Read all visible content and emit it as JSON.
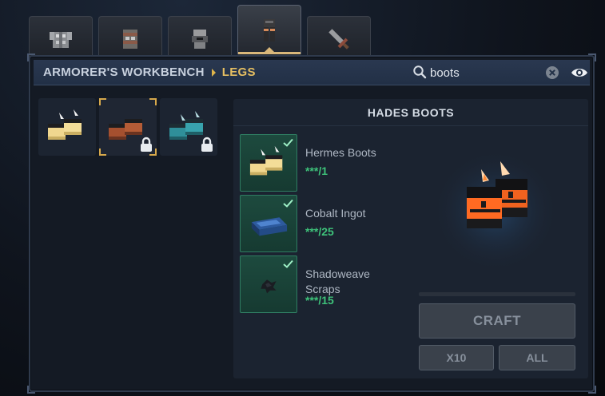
{
  "tabs": [
    {
      "id": "chest",
      "icon": "chestplate-icon",
      "active": false
    },
    {
      "id": "helmet",
      "icon": "helmet-icon",
      "active": false
    },
    {
      "id": "armor",
      "icon": "armor-icon",
      "active": false
    },
    {
      "id": "legs",
      "icon": "leggings-icon",
      "active": true
    },
    {
      "id": "weapon",
      "icon": "weapon-icon",
      "active": false
    }
  ],
  "header": {
    "breadcrumb_first": "ARMORER'S WORKBENCH",
    "breadcrumb_second": "LEGS",
    "search_value": "boots"
  },
  "recipes": [
    {
      "name": "hermes-boots",
      "icon": "hermes-boots-icon",
      "locked": false,
      "selected": false
    },
    {
      "name": "hades-boots",
      "icon": "hades-boots-icon",
      "locked": true,
      "selected": true
    },
    {
      "name": "cobalt-boots",
      "icon": "cobalt-boots-icon",
      "locked": true,
      "selected": false
    }
  ],
  "detail": {
    "title": "HADES BOOTS",
    "ingredients": [
      {
        "name": "Hermes Boots",
        "count": "***/1",
        "icon": "hermes-boots-icon",
        "checked": true
      },
      {
        "name": "Cobalt Ingot",
        "count": "***/25",
        "icon": "cobalt-ingot-icon",
        "checked": true
      },
      {
        "name": "Shadoweave Scraps",
        "count": "***/15",
        "icon": "shadoweave-scraps-icon",
        "checked": true
      }
    ],
    "progress": 0
  },
  "buttons": {
    "craft": "CRAFT",
    "x10": "X10",
    "all": "ALL"
  },
  "colors": {
    "accent_gold": "#e6bf62",
    "check_green": "#3ec27a",
    "header_blue": "#223046"
  }
}
